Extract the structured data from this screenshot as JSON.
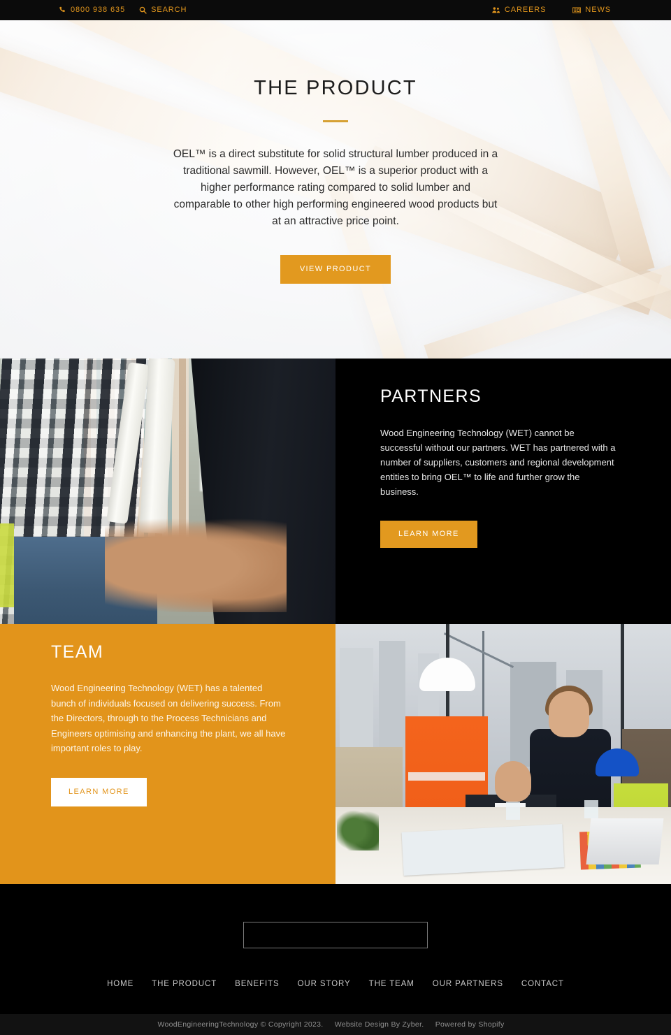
{
  "topbar": {
    "phone": {
      "icon": "phone-icon",
      "label": "0800 938 635"
    },
    "search": {
      "icon": "search-icon",
      "label": "SEARCH"
    },
    "careers": {
      "icon": "users-icon",
      "label": "CAREERS"
    },
    "news": {
      "icon": "newspaper-icon",
      "label": "NEWS"
    },
    "accent_color": "#e0951d",
    "background_color": "#0b0b0b"
  },
  "hero": {
    "title": "THE PRODUCT",
    "body": "OEL™ is a direct substitute for solid structural lumber produced in a traditional sawmill. However, OEL™ is a superior product with a higher performance rating compared to solid lumber and comparable to other high performing engineered wood products but at an attractive price point.",
    "cta_label": "VIEW PRODUCT",
    "divider_color": "#d6a134",
    "background_image_alt": "timber-beams-background"
  },
  "partners": {
    "title": "PARTNERS",
    "body": "Wood Engineering Technology (WET) cannot be successful without our partners. WET has partnered with a number of suppliers, customers and regional development entities to bring OEL™ to life and further grow the business.",
    "cta_label": "LEARN MORE",
    "background_color": "#000000",
    "image_alt": "handshake-business-partners-photo"
  },
  "team": {
    "title": "TEAM",
    "body": "Wood Engineering Technology (WET) has a talented bunch of individuals focused on delivering success. From the Directors, through to the Process Technicians and Engineers optimising and enhancing the plant, we all have important roles to play.",
    "cta_label": "LEARN MORE",
    "background_color": "#e2941b",
    "image_alt": "construction-team-meeting-photo"
  },
  "footer": {
    "nav": [
      {
        "label": "HOME"
      },
      {
        "label": "THE PRODUCT"
      },
      {
        "label": "BENEFITS"
      },
      {
        "label": "OUR STORY"
      },
      {
        "label": "THE TEAM"
      },
      {
        "label": "OUR PARTNERS"
      },
      {
        "label": "CONTACT"
      }
    ],
    "copyright": "WoodEngineeringTechnology © Copyright 2023.",
    "design_credit": "Website Design By Zyber.",
    "platform_credit": "Powered by Shopify"
  },
  "theme": {
    "accent_orange": "#e2991f",
    "team_orange": "#e2941b",
    "dark": "#000000"
  }
}
